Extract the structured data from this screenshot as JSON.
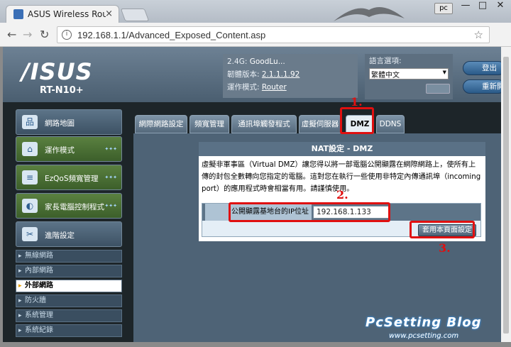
{
  "browser": {
    "tab_title": "ASUS Wireless Router R",
    "tab_close": "×",
    "user_badge": "pc",
    "url": "192.168.1.1/Advanced_Exposed_Content.asp",
    "win_min": "—",
    "win_max": "□",
    "win_close": "✕"
  },
  "header": {
    "brand": "/ISUS",
    "model": "RT-N10+",
    "ssid_label": "2.4G: ",
    "ssid_value": "GoodLu...",
    "firmware_label": "韌體版本: ",
    "firmware_value": "2.1.1.1.92",
    "mode_label": "運作模式: ",
    "mode_value": "Router",
    "language_label": "語言選項:",
    "language_value": "繁體中文",
    "logout_label": "登出",
    "reboot_label": "重新開機"
  },
  "sidebar": {
    "items": [
      {
        "label": "網路地圖",
        "icon": "network-map-icon"
      },
      {
        "label": "運作模式",
        "icon": "router-icon"
      },
      {
        "label": "EzQoS頻寬管理",
        "icon": "qos-icon"
      },
      {
        "label": "家長電腦控制程式",
        "icon": "parental-icon"
      },
      {
        "label": "進階設定",
        "icon": "tools-icon"
      }
    ],
    "sub_items": [
      "無線網路",
      "內部網路",
      "外部網路",
      "防火牆",
      "系統管理",
      "系統紀錄"
    ],
    "active_sub": "外部網路"
  },
  "main": {
    "tabs": [
      "網際網路設定",
      "頻寬管理",
      "通訊埠觸發程式",
      "虛擬伺服器",
      "DMZ",
      "DDNS"
    ],
    "active_tab": "DMZ",
    "panel_title": "NAT設定 - DMZ",
    "description": "虛擬非軍事區（Virtual DMZ）讓您得以將一部電腦公開顯露在網際網路上，使所有上傳的封包全數轉向您指定的電腦。這對您在執行一些使用非特定內傳通訊埠（incoming port）的應用程式時會相當有用。請謹慎使用。",
    "field_label": "公開顯露基地台的IP位址",
    "field_value": "192.168.1.133",
    "apply_button": "套用本頁面設定"
  },
  "annotations": {
    "step1": "1.",
    "step2": "2.",
    "step3": "3.",
    "color": "#e01010"
  },
  "watermark": {
    "title": "PcSetting Blog",
    "url": "www.pcsetting.com"
  }
}
